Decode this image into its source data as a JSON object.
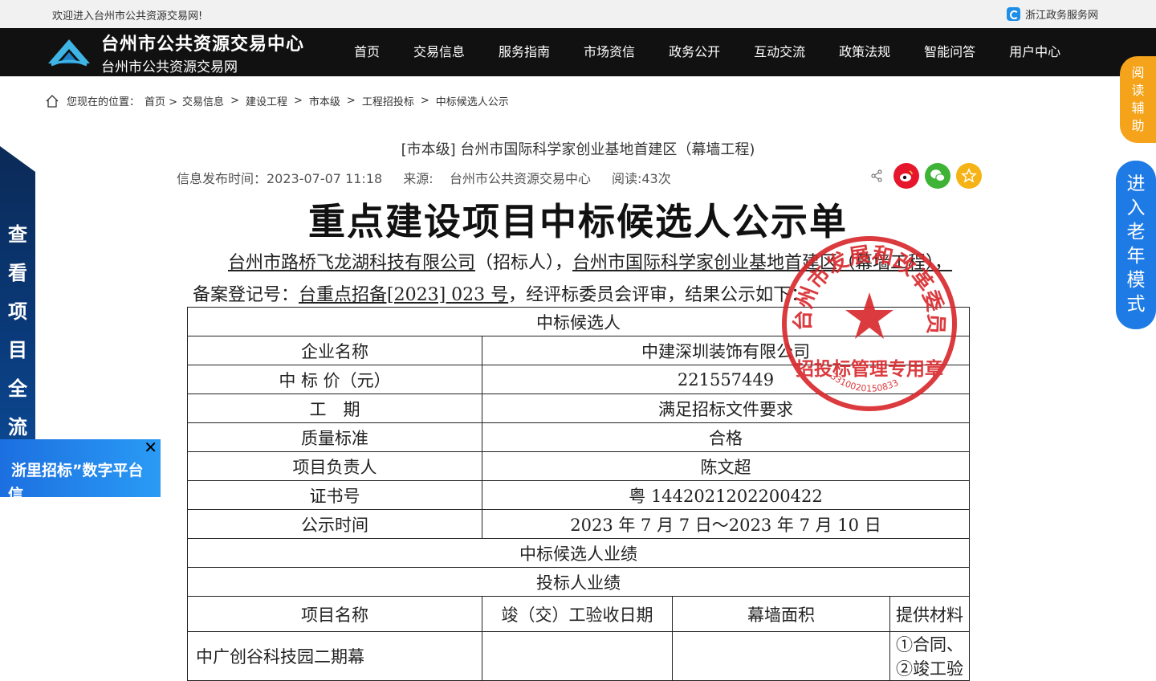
{
  "topbar": {
    "welcome": "欢迎进入台州市公共资源交易网!",
    "zj_link": "浙江政务服务网",
    "zj_icon": "zjzw-logo-icon"
  },
  "header": {
    "brand_title": "台州市公共资源交易中心",
    "brand_subtitle": "台州市公共资源交易网",
    "nav": [
      "首页",
      "交易信息",
      "服务指南",
      "市场资信",
      "政务公开",
      "互动交流",
      "政策法规",
      "智能问答",
      "用户中心"
    ]
  },
  "breadcrumb": {
    "prefix": "您现在的位置：",
    "items": [
      "首页 >",
      "交易信息",
      "建设工程",
      "市本级",
      "工程招投标",
      "中标候选人公示"
    ],
    "separator": ">"
  },
  "article": {
    "title": "[市本级] 台州市国际科学家创业基地首建区（幕墙工程)",
    "published": "信息发布时间：2023-07-07 11:18",
    "source_label": "来源:",
    "source": "台州市公共资源交易中心",
    "reads": "阅读:43次",
    "share_icons": [
      "share-icon",
      "weibo-icon",
      "wechat-icon",
      "favorite-icon"
    ]
  },
  "document": {
    "heading": "重点建设项目中标候选人公示单",
    "para": {
      "tenderer": "台州市路桥飞龙湖科技有限公司",
      "t1": "（招标人），",
      "project": "台州市国际科学家创业基地首建区（幕墙工程），",
      "t2": "备案登记号：",
      "reg_no": "台重点招备[2023] 023 号",
      "t3": "，经评标委员会评审，结果公示如下："
    },
    "table": {
      "section1": "中标候选人",
      "rows": [
        {
          "label": "企业名称",
          "value": "中建深圳装饰有限公司"
        },
        {
          "label": "中 标 价（元）",
          "value": "221557449"
        },
        {
          "label": "工　期",
          "value": "满足招标文件要求"
        },
        {
          "label": "质量标准",
          "value": "合格"
        },
        {
          "label": "项目负责人",
          "value": "陈文超"
        },
        {
          "label": "证书号",
          "value": "粤 1442021202200422"
        },
        {
          "label": "公示时间",
          "value": "2023 年 7 月 7 日～2023 年 7 月 10 日"
        }
      ],
      "section2": "中标候选人业绩",
      "section3": "投标人业绩",
      "perf_headers": [
        "项目名称",
        "竣（交）工验收日期",
        "幕墙面积",
        "提供材料"
      ],
      "perf_row_partial": [
        "中广创谷科技园二期幕",
        "",
        "",
        "①合同、②竣工验"
      ]
    },
    "stamp": {
      "outer_text": "台州市发展和改革委员会",
      "inner_text": "招投标管理专用章",
      "number": "3310020150833",
      "color": "#d8262a"
    }
  },
  "widgets": {
    "left_panel_text": "查看项目全流程",
    "banner_text": "浙里招标”数字平台",
    "banner_text2": "信",
    "banner_close": "close-icon",
    "read_aid": "阅读辅助",
    "elder_mode": "进入老年模式"
  }
}
